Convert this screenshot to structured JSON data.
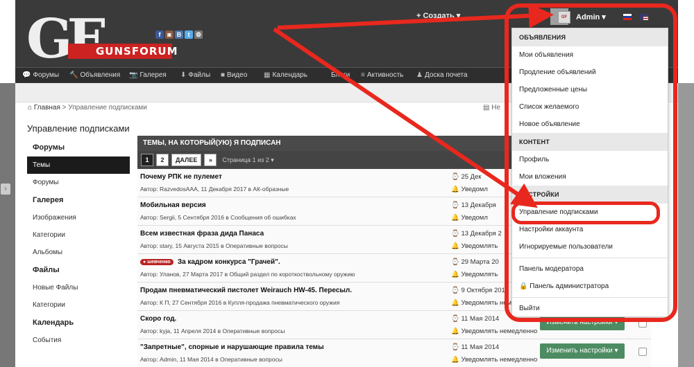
{
  "logo": {
    "text": "GF",
    "brand": "GUNSFORUM"
  },
  "social": [
    {
      "name": "facebook-icon",
      "glyph": "f",
      "color": "#3b5998"
    },
    {
      "name": "instagram-icon",
      "glyph": "◙",
      "color": "#8a5a44"
    },
    {
      "name": "vk-icon",
      "glyph": "B",
      "color": "#4c75a3"
    },
    {
      "name": "twitter-icon",
      "glyph": "t",
      "color": "#55acee"
    },
    {
      "name": "settings-icon",
      "glyph": "⚙",
      "color": "#777"
    }
  ],
  "topnav": {
    "create": "+ Создать ▾"
  },
  "user": {
    "name": "Admin ▾",
    "avatar": "GF"
  },
  "nav": [
    {
      "icon": "💬",
      "label": "Форумы"
    },
    {
      "icon": "🔨",
      "label": "Объявления"
    },
    {
      "icon": "📷",
      "label": "Галерея"
    },
    {
      "icon": "⬇",
      "label": "Файлы"
    },
    {
      "icon": "■",
      "label": "Видео"
    },
    {
      "icon": "▦",
      "label": "Календарь"
    },
    {
      "icon": "",
      "label": "Блоги"
    },
    {
      "icon": "≡",
      "label": "Активность"
    },
    {
      "icon": "♟",
      "label": "Доска почета"
    }
  ],
  "breadcrumb": {
    "home": "Главная",
    "sep": ">",
    "current": "Управление подписками"
  },
  "new_flag": "Не",
  "panel_title": "Управление подписками",
  "sidebar": [
    {
      "type": "h",
      "label": "Форумы"
    },
    {
      "type": "i",
      "label": "Темы",
      "active": true
    },
    {
      "type": "i",
      "label": "Форумы"
    },
    {
      "type": "h",
      "label": "Галерея"
    },
    {
      "type": "i",
      "label": "Изображения"
    },
    {
      "type": "i",
      "label": "Категории"
    },
    {
      "type": "i",
      "label": "Альбомы"
    },
    {
      "type": "h",
      "label": "Файлы"
    },
    {
      "type": "i",
      "label": "Новые Файлы"
    },
    {
      "type": "i",
      "label": "Категории"
    },
    {
      "type": "h",
      "label": "Календарь"
    },
    {
      "type": "i",
      "label": "События"
    }
  ],
  "table": {
    "title": "ТЕМЫ, НА КОТОРЫЙ(УЮ) Я ПОДПИСАН",
    "pages": [
      "1",
      "2",
      "ДАЛЕЕ",
      "»"
    ],
    "page_info": "Страница 1 из 2 ▾",
    "rows": [
      {
        "title": "Почему РПК не пулемет",
        "author": "Автор: RazvedosAAA, 11 Декабря 2017 в АК-образные",
        "date": "⌚ 25 Дек",
        "notify": "🔔 Уведомл",
        "tag": "",
        "button": "",
        "check": false
      },
      {
        "title": "Мобильная версия",
        "author": "Автор: Sergii, 5 Сентября 2016 в Сообщения об ошибках",
        "date": "⌚ 13 Декабря",
        "notify": "🔔 Уведомл",
        "tag": "",
        "button": "",
        "check": false
      },
      {
        "title": "Всем известная фраза дида Панаса",
        "author": "Автор: stary, 15 Августа 2015 в Оперативные вопросы",
        "date": "⌚ 13 Декабря 2",
        "notify": "🔔 Уведомлять",
        "tag": "",
        "button": "",
        "check": false
      },
      {
        "title": "За кадром конкурса \"Грачей\".",
        "author": "Автор: Уланов, 27 Марта 2017 в Общий раздел по короткоствольному оружию",
        "date": "⌚ 29 Марта 20",
        "notify": "🔔 Уведомлять",
        "tag": "● шевченко",
        "button": "",
        "check": false
      },
      {
        "title": "Продам пневматический пистолет Weirauch HW-45. Пересыл.",
        "author": "Автор: К П, 27 Сентября 2016 в Купля-продажа пневматического оружия",
        "date": "⌚ 9 Октября 2016",
        "notify": "🔔 Уведомлять немедленно",
        "tag": "",
        "button": "",
        "check": false
      },
      {
        "title": "Скоро год.",
        "author": "Автор: kyja, 11 Апреля 2014 в Оперативные вопросы",
        "date": "⌚ 11 Мая 2014",
        "notify": "🔔 Уведомлять немедленно",
        "tag": "",
        "button": "Изменить настройки ▾",
        "check": true
      },
      {
        "title": "\"Запретные\", спорные и нарушающие правила темы",
        "author": "Автор: Admin, 11 Мая 2014 в Оперативные вопросы",
        "date": "⌚ 11 Мая 2014",
        "notify": "🔔 Уведомлять немедленно",
        "tag": "",
        "button": "Изменить настройки ▾",
        "check": true
      }
    ]
  },
  "dropdown": {
    "sections": [
      {
        "header": "ОБЪЯВЛЕНИЯ",
        "items": [
          "Мои объявления",
          "Продление объявлений",
          "Предложенные цены",
          "Список желаемого",
          "Новое объявление"
        ]
      },
      {
        "header": "КОНТЕНТ",
        "items": [
          "Профиль",
          "Мои вложения"
        ]
      },
      {
        "header": "НАСТРОЙКИ",
        "items": [
          "Управление подписками",
          "Настройки аккаунта",
          "Игнорируемые пользователи"
        ]
      }
    ],
    "extra": [
      "Панель модератора",
      "🔒 Панель администратора"
    ],
    "logout": "Выйти"
  },
  "colors": {
    "highlight": "#e8281e",
    "button": "#4d8c62"
  }
}
